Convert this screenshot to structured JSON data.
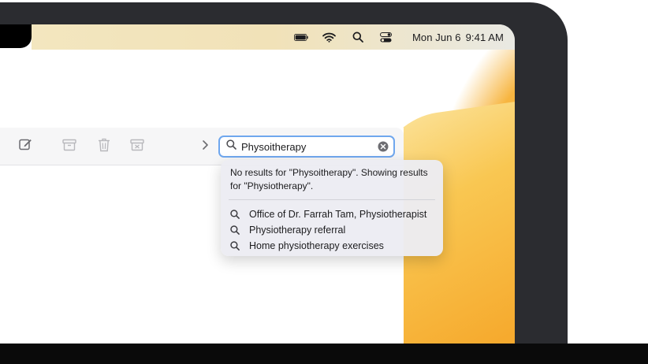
{
  "menubar": {
    "date": "Mon Jun 6",
    "time": "9:41 AM"
  },
  "toolbar": {
    "buttons": [
      "compose-icon",
      "archive-icon",
      "trash-icon",
      "junk-icon",
      "chevron-right-icon"
    ]
  },
  "search": {
    "value": "Physoitherapy",
    "icon": "search-icon",
    "clear_icon": "clear-icon"
  },
  "suggestions": {
    "no_results": "No results for \"Physoitherapy\". Showing results for \"Physiotherapy\".",
    "items": [
      {
        "label": "Office of Dr. Farrah Tam, Physiotherapist"
      },
      {
        "label": "Physiotherapy referral"
      },
      {
        "label": "Home physiotherapy exercises"
      }
    ]
  },
  "colors": {
    "accent_focus": "#6fa7ee",
    "wallpaper_orange": "#f6aa2e",
    "wallpaper_blue": "#3d86d2"
  }
}
